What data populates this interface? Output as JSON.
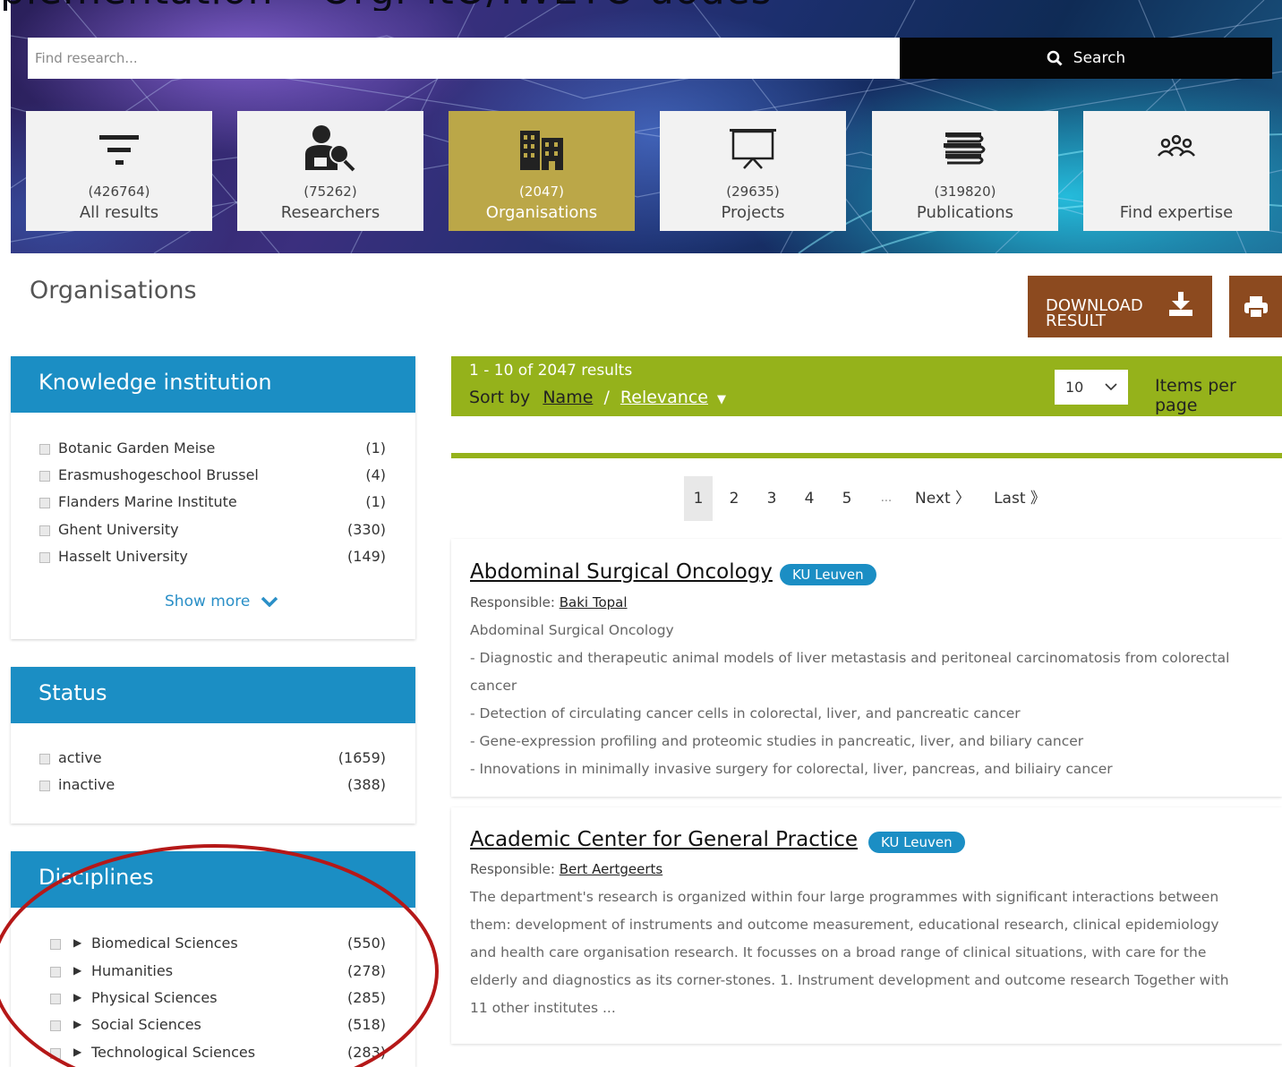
{
  "hero": {
    "banner_title": "plementation – Orgr ItO/IWETO uodes"
  },
  "search": {
    "placeholder": "Find research...",
    "button_label": "Search"
  },
  "tiles": [
    {
      "count": "(426764)",
      "label": "All results",
      "icon": "filter-icon"
    },
    {
      "count": "(75262)",
      "label": "Researchers",
      "icon": "researcher-icon"
    },
    {
      "count": "(2047)",
      "label": "Organisations",
      "icon": "building-icon",
      "active": true
    },
    {
      "count": "(29635)",
      "label": "Projects",
      "icon": "presentation-icon"
    },
    {
      "count": "(319820)",
      "label": "Publications",
      "icon": "books-icon"
    },
    {
      "count": "",
      "label": "Find expertise",
      "icon": "people-group-icon"
    }
  ],
  "page": {
    "title": "Organisations",
    "download_label_line1": "DOWNLOAD",
    "download_label_line2": "RESULT"
  },
  "facets": {
    "knowledge": {
      "title": "Knowledge institution",
      "items": [
        {
          "name": "Botanic Garden Meise",
          "count": "(1)"
        },
        {
          "name": "Erasmushogeschool Brussel",
          "count": "(4)"
        },
        {
          "name": "Flanders Marine Institute",
          "count": "(1)"
        },
        {
          "name": "Ghent University",
          "count": "(330)"
        },
        {
          "name": "Hasselt University",
          "count": "(149)"
        }
      ],
      "show_more": "Show more"
    },
    "status": {
      "title": "Status",
      "items": [
        {
          "name": "active",
          "count": "(1659)"
        },
        {
          "name": "inactive",
          "count": "(388)"
        }
      ]
    },
    "disciplines": {
      "title": "Disciplines",
      "items": [
        {
          "name": "Biomedical Sciences",
          "count": "(550)"
        },
        {
          "name": "Humanities",
          "count": "(278)"
        },
        {
          "name": "Physical Sciences",
          "count": "(285)"
        },
        {
          "name": "Social Sciences",
          "count": "(518)"
        },
        {
          "name": "Technological Sciences",
          "count": "(283)"
        }
      ]
    }
  },
  "results": {
    "count_text": "1 - 10 of 2047 results",
    "sort_by": "Sort by",
    "sort_name": "Name",
    "sort_sep": "/",
    "sort_relevance": "Relevance",
    "per_page_value": "10",
    "per_page_label": "Items per page",
    "pagination": [
      "1",
      "2",
      "3",
      "4",
      "5",
      "...",
      "Next 〉",
      "Last 》"
    ],
    "items": [
      {
        "title": "Abdominal Surgical Oncology",
        "badge": "KU Leuven",
        "responsible_label": "Responsible:",
        "responsible_name": "Baki Topal",
        "lines": [
          "Abdominal Surgical Oncology",
          "- Diagnostic and therapeutic animal models of liver metastasis and peritoneal carcinomatosis from colorectal cancer",
          "- Detection of circulating cancer cells in colorectal, liver, and pancreatic cancer",
          "- Gene-expression profiling and proteomic studies in pancreatic, liver, and biliary cancer",
          "- Innovations in minimally invasive surgery for colorectal, liver, pancreas, and biliairy cancer"
        ]
      },
      {
        "title": "Academic Center for General Practice",
        "badge": "KU Leuven",
        "responsible_label": "Responsible:",
        "responsible_name": "Bert Aertgeerts",
        "lines": [
          "The department's research is organized within four large programmes with significant interactions between them: development of instruments and outcome measurement, educational research, clinical epidemiology and health care organisation research. It focusses on a broad range of clinical situations, with care for the elderly and diagnostics as its corner-stones. 1. Instrument development and outcome research Together with 11 other institutes ..."
        ]
      }
    ]
  },
  "colors": {
    "facet_header": "#1b8ec4",
    "results_bar": "#95b21b",
    "active_tile": "#bba748",
    "download_button": "#8c4a1f",
    "annotation_circle": "#b51818"
  }
}
